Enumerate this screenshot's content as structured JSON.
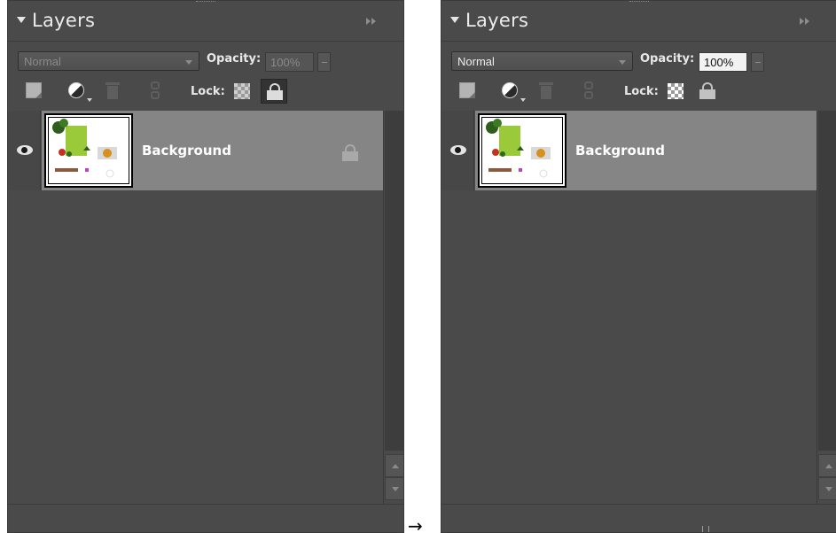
{
  "transition_arrow": "→",
  "before": {
    "title": "Layers",
    "blend_mode": "Normal",
    "opacity_label": "Opacity:",
    "opacity_value": "100%",
    "lock_label": "Lock:",
    "layer_name": "Background"
  },
  "after": {
    "title": "Layers",
    "blend_mode": "Normal",
    "opacity_label": "Opacity:",
    "opacity_value": "100%",
    "lock_label": "Lock:",
    "layer_name": "Background"
  },
  "icons": {
    "collapse": "triangle-down-icon",
    "flyout": "double-chevron-right-icon",
    "new_layer": "new-layer-icon",
    "adjustment": "adjustment-layer-icon",
    "delete": "trash-icon",
    "link": "link-icon",
    "lock_transparent": "checkerboard-icon",
    "lock_all": "padlock-icon",
    "visibility": "eye-icon"
  }
}
